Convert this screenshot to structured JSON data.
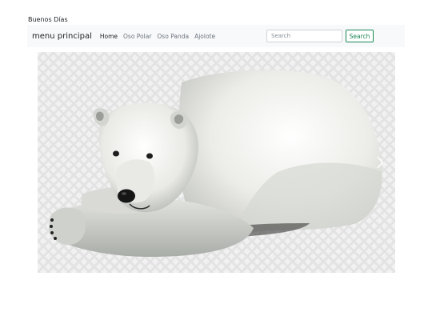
{
  "header": {
    "greeting": "Buenos Días"
  },
  "navbar": {
    "brand": "menu principal",
    "links": [
      {
        "label": "Home",
        "active": true
      },
      {
        "label": "Oso Polar",
        "active": false
      },
      {
        "label": "Oso Panda",
        "active": false
      },
      {
        "label": "Ajolote",
        "active": false
      }
    ],
    "search": {
      "placeholder": "Search",
      "value": "",
      "button_label": "Search"
    }
  },
  "carousel": {
    "image_subject": "polar bear",
    "next_icon": "chevron-right-icon",
    "prev_icon": "chevron-left-icon"
  },
  "colors": {
    "navbar_bg": "#f8f9fa",
    "search_button": "#198754",
    "nav_link_muted": "#6c757d"
  }
}
